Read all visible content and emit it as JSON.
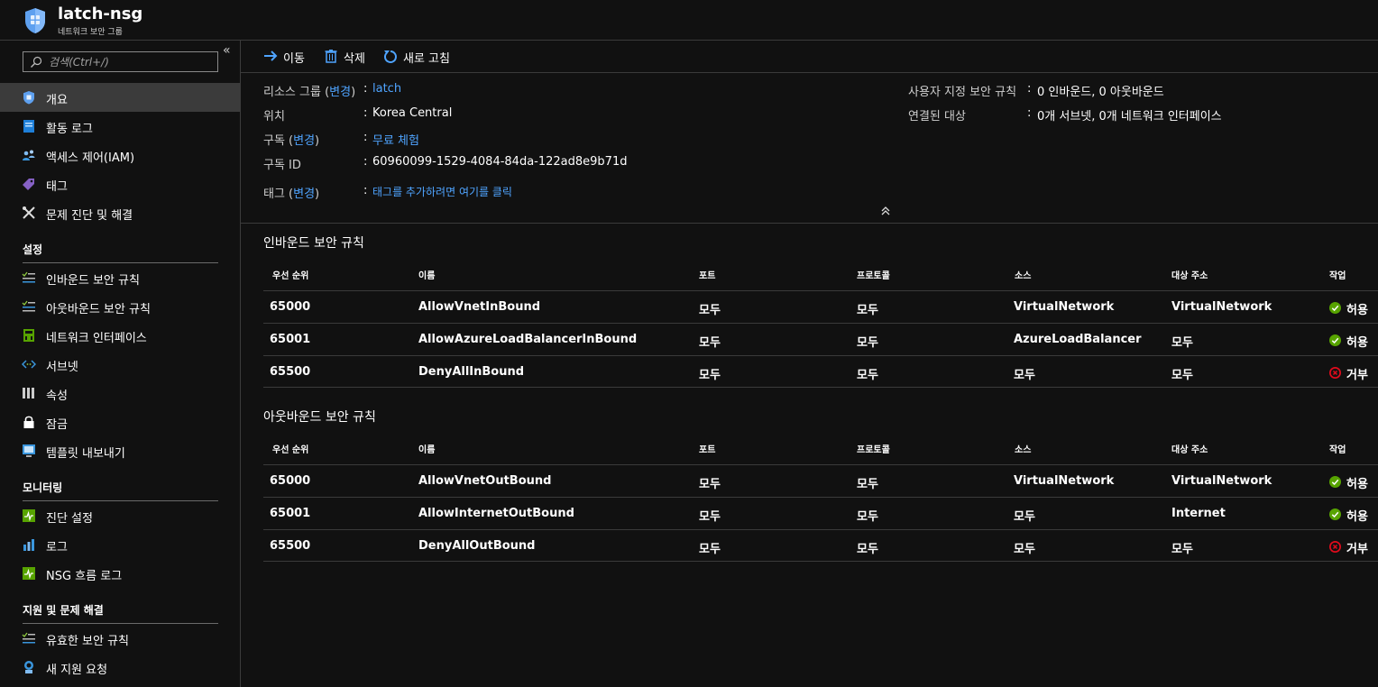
{
  "header": {
    "title": "latch-nsg",
    "subtitle": "네트워크 보안 그룹",
    "logo_icon": "shield-icon"
  },
  "sidebar": {
    "collapse_icon": "double-chevron-left-icon",
    "search_placeholder": "검색(Ctrl+/)",
    "items_top": [
      {
        "label": "개요",
        "icon": "shield-icon",
        "active": true
      },
      {
        "label": "활동 로그",
        "icon": "activity-log-icon"
      },
      {
        "label": "액세스 제어(IAM)",
        "icon": "iam-icon"
      },
      {
        "label": "태그",
        "icon": "tag-icon"
      },
      {
        "label": "문제 진단 및 해결",
        "icon": "wrench-icon"
      }
    ],
    "section_settings": "설정",
    "items_settings": [
      {
        "label": "인바운드 보안 규칙",
        "icon": "inbound-rules-icon"
      },
      {
        "label": "아웃바운드 보안 규칙",
        "icon": "outbound-rules-icon"
      },
      {
        "label": "네트워크 인터페이스",
        "icon": "nic-icon"
      },
      {
        "label": "서브넷",
        "icon": "subnet-icon"
      },
      {
        "label": "속성",
        "icon": "properties-icon"
      },
      {
        "label": "잠금",
        "icon": "lock-icon"
      },
      {
        "label": "템플릿 내보내기",
        "icon": "export-template-icon"
      }
    ],
    "section_monitoring": "모니터링",
    "items_monitoring": [
      {
        "label": "진단 설정",
        "icon": "diagnostics-icon"
      },
      {
        "label": "로그",
        "icon": "logs-icon"
      },
      {
        "label": "NSG 흐름 로그",
        "icon": "flow-log-icon"
      }
    ],
    "section_support": "지원 및 문제 해결",
    "items_support": [
      {
        "label": "유효한 보안 규칙",
        "icon": "effective-rules-icon"
      },
      {
        "label": "새 지원 요청",
        "icon": "support-request-icon"
      }
    ]
  },
  "toolbar": {
    "move": "이동",
    "delete": "삭제",
    "refresh": "새로 고침"
  },
  "essentials": {
    "rg_label": "리소스 그룹 (",
    "change": "변경",
    "rg_label_end": ")",
    "rg_value": "latch",
    "location_label": "위치",
    "location_value": "Korea Central",
    "sub_label": "구독 (",
    "sub_label_end": ")",
    "sub_value": "무료 체험",
    "subid_label": "구독 ID",
    "subid_value": "60960099-1529-4084-84da-122ad8e9b71d",
    "tags_label": "태그 (",
    "tags_label_end": ")",
    "tags_value": "태그를 추가하려면 여기를 클릭",
    "custom_rules_label": "사용자 지정 보안 규칙",
    "custom_rules_value": "0 인바운드, 0 아웃바운드",
    "assoc_label": "연결된 대상",
    "assoc_value": "0개 서브넷, 0개 네트워크 인터페이스",
    "colon": ":"
  },
  "columns": [
    "우선 순위",
    "이름",
    "포트",
    "프로토콜",
    "소스",
    "대상 주소",
    "작업"
  ],
  "inbound": {
    "title": "인바운드 보안 규칙",
    "rows": [
      {
        "priority": "65000",
        "name": "AllowVnetInBound",
        "port": "모두",
        "protocol": "모두",
        "source": "VirtualNetwork",
        "dest": "VirtualNetwork",
        "action": "허용",
        "allow": true
      },
      {
        "priority": "65001",
        "name": "AllowAzureLoadBalancerInBound",
        "port": "모두",
        "protocol": "모두",
        "source": "AzureLoadBalancer",
        "dest": "모두",
        "action": "허용",
        "allow": true
      },
      {
        "priority": "65500",
        "name": "DenyAllInBound",
        "port": "모두",
        "protocol": "모두",
        "source": "모두",
        "dest": "모두",
        "action": "거부",
        "allow": false
      }
    ]
  },
  "outbound": {
    "title": "아웃바운드 보안 규칙",
    "rows": [
      {
        "priority": "65000",
        "name": "AllowVnetOutBound",
        "port": "모두",
        "protocol": "모두",
        "source": "VirtualNetwork",
        "dest": "VirtualNetwork",
        "action": "허용",
        "allow": true
      },
      {
        "priority": "65001",
        "name": "AllowInternetOutBound",
        "port": "모두",
        "protocol": "모두",
        "source": "모두",
        "dest": "Internet",
        "action": "허용",
        "allow": true
      },
      {
        "priority": "65500",
        "name": "DenyAllOutBound",
        "port": "모두",
        "protocol": "모두",
        "source": "모두",
        "dest": "모두",
        "action": "거부",
        "allow": false
      }
    ]
  },
  "colors": {
    "link": "#4fa4ff",
    "allow": "#57a300",
    "deny": "#e00b1c",
    "accent": "#0078d4"
  }
}
